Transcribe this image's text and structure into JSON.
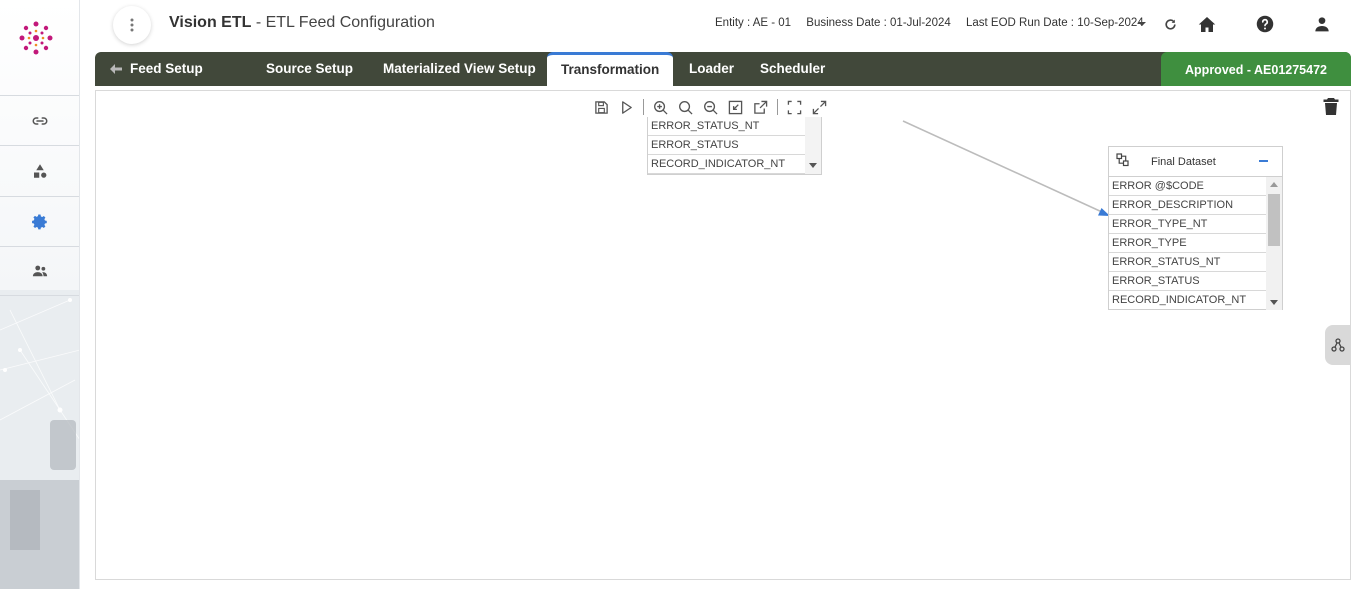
{
  "header": {
    "app_name": "Vision ETL",
    "separator": " - ",
    "page_title": "ETL Feed Configuration",
    "entity_label": "Entity :",
    "entity_value": "AE - 01",
    "business_date_label": "Business Date :",
    "business_date_value": "01-Jul-2024",
    "eod_label": "Last EOD Run Date :",
    "eod_value": "10-Sep-2024"
  },
  "tabs": {
    "feed_setup": "Feed Setup",
    "source_setup": "Source Setup",
    "mv_setup": "Materialized View Setup",
    "transformation": "Transformation",
    "loader": "Loader",
    "scheduler": "Scheduler",
    "status": "Approved - AE01275472"
  },
  "source_list": {
    "rows": [
      "ERROR_STATUS_NT",
      "ERROR_STATUS",
      "RECORD_INDICATOR_NT"
    ]
  },
  "final_dataset": {
    "title": "Final Dataset",
    "rows": [
      "ERROR @$CODE",
      "ERROR_DESCRIPTION",
      "ERROR_TYPE_NT",
      "ERROR_TYPE",
      "ERROR_STATUS_NT",
      "ERROR_STATUS",
      "RECORD_INDICATOR_NT"
    ]
  },
  "colors": {
    "tabbar": "#41483a",
    "approved": "#3f8f3f",
    "accent": "#3a7bd5"
  }
}
